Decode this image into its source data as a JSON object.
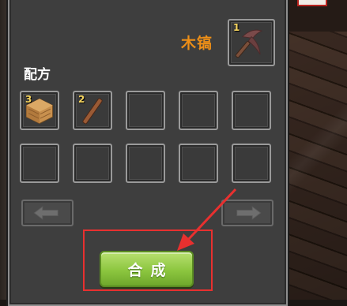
{
  "recipe": {
    "result_name": "木镐",
    "result_item": {
      "icon": "wooden-pickaxe-icon",
      "count": "1"
    },
    "section_label": "配方",
    "ingredients": [
      {
        "icon": "wood-planks-icon",
        "count": "3"
      },
      {
        "icon": "stick-icon",
        "count": "2"
      }
    ],
    "empty_slot_count": 8
  },
  "actions": {
    "craft_label": "合成"
  },
  "colors": {
    "title": "#ee8f17",
    "craft_button": "#8cc63f",
    "highlight": "#e8302f",
    "count_text": "#f4d35e"
  }
}
